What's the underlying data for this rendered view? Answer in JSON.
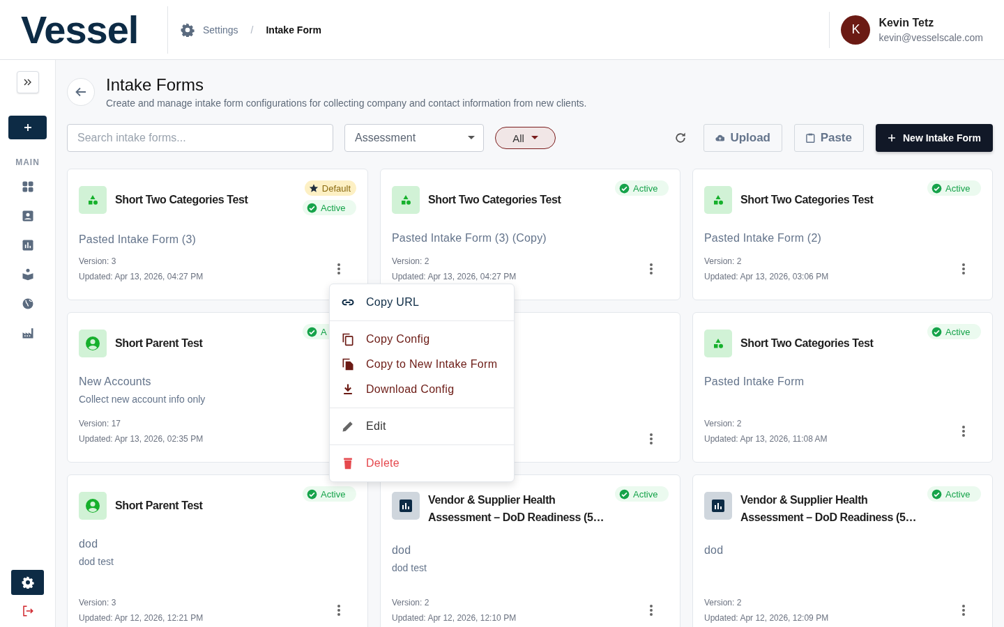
{
  "header": {
    "logo": "Vessel",
    "separator": "/",
    "breadcrumb": [
      {
        "label": "Settings",
        "current": false
      },
      {
        "label": "Intake Form",
        "current": true
      }
    ],
    "user": {
      "initial": "K",
      "name": "Kevin Tetz",
      "email": "kevin@vesselscale.com"
    }
  },
  "sidebar": {
    "section": "MAIN"
  },
  "page": {
    "title": "Intake Forms",
    "subtitle": "Create and manage intake form configurations for collecting company and contact information from new clients."
  },
  "toolbar": {
    "search": {
      "placeholder": "Search intake forms..."
    },
    "type_select": {
      "value": "Assessment"
    },
    "status_filter": {
      "value": "All"
    },
    "upload": "Upload",
    "paste": "Paste",
    "new": "New Intake Form"
  },
  "cards": [
    {
      "kind": "shapes",
      "title": "Short Two Categories Test",
      "badges": [
        {
          "kind": "default",
          "label": "Default"
        },
        {
          "kind": "active",
          "label": "Active"
        }
      ],
      "subtitle": "Pasted Intake Form (3)",
      "version": "Version: 3",
      "updated": "Updated: Apr 13, 2026, 04:27 PM",
      "menu_button": true
    },
    {
      "kind": "shapes",
      "title": "Short Two Categories Test",
      "badges": [
        {
          "kind": "active",
          "label": "Active"
        }
      ],
      "subtitle": "Pasted Intake Form (3) (Copy)",
      "version": "Version: 2",
      "updated": "Updated: Apr 13, 2026, 04:27 PM",
      "menu_button": true
    },
    {
      "kind": "shapes",
      "title": "Short Two Categories Test",
      "badges": [
        {
          "kind": "active",
          "label": "Active"
        }
      ],
      "subtitle": "Pasted Intake Form (2)",
      "version": "Version: 2",
      "updated": "Updated: Apr 13, 2026, 03:06 PM",
      "menu_button": true
    },
    {
      "kind": "person",
      "title": "Short Parent Test",
      "badges": [
        {
          "kind": "active",
          "label": "A"
        }
      ],
      "subtitle": "New Accounts",
      "description": "Collect new account info only",
      "version": "Version: 17",
      "updated": "Updated: Apr 13, 2026, 02:35 PM",
      "menu_button": false
    },
    {
      "menu_button": true
    },
    {
      "kind": "shapes",
      "title": "Short Two Categories Test",
      "badges": [
        {
          "kind": "active",
          "label": "Active"
        }
      ],
      "subtitle": "Pasted Intake Form",
      "version": "Version: 2",
      "updated": "Updated: Apr 13, 2026, 11:08 AM",
      "menu_button": true
    },
    {
      "kind": "person",
      "title": "Short Parent Test",
      "badges": [
        {
          "kind": "active",
          "label": "Active"
        }
      ],
      "subtitle": "dod",
      "description": "dod test",
      "version": "Version: 3",
      "updated": "Updated: Apr 12, 2026, 12:21 PM",
      "menu_button": true
    },
    {
      "kind": "chart",
      "title": "Vendor & Supplier Health Assessment – DoD Readiness (5…",
      "badges": [
        {
          "kind": "active",
          "label": "Active"
        }
      ],
      "subtitle": "dod",
      "description": "dod test",
      "version": "Version: 2",
      "updated": "Updated: Apr 12, 2026, 12:10 PM",
      "menu_button": true
    },
    {
      "kind": "chart",
      "title": "Vendor & Supplier Health Assessment – DoD Readiness (5…",
      "badges": [
        {
          "kind": "active",
          "label": "Active"
        }
      ],
      "subtitle": "dod",
      "version": "Version: 2",
      "updated": "Updated: Apr 12, 2026, 12:09 PM",
      "menu_button": true
    }
  ],
  "context_menu": {
    "groups": [
      [
        {
          "kind": "link",
          "label": "Copy URL"
        }
      ],
      [
        {
          "kind": "copy",
          "label": "Copy Config"
        },
        {
          "kind": "duplicate",
          "label": "Copy to New Intake Form"
        },
        {
          "kind": "download",
          "label": "Download Config"
        }
      ],
      [
        {
          "kind": "edit",
          "label": "Edit"
        }
      ],
      [
        {
          "kind": "delete",
          "label": "Delete"
        }
      ]
    ]
  }
}
